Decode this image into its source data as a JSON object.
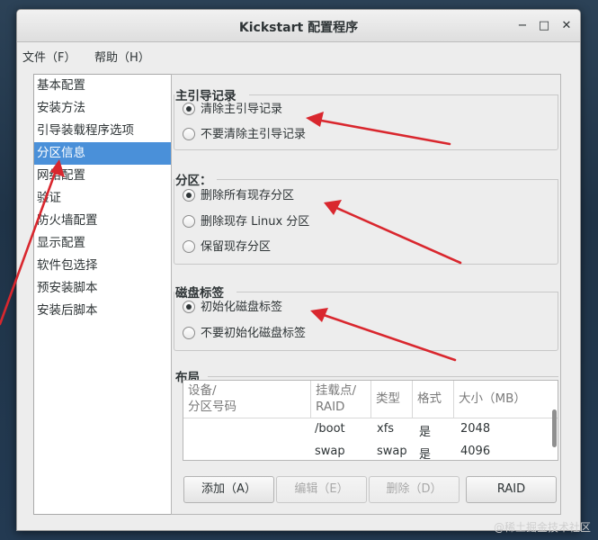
{
  "window": {
    "title": "Kickstart 配置程序"
  },
  "window_controls": {
    "minimize": "−",
    "maximize": "□",
    "close": "✕"
  },
  "menubar": {
    "file": "文件（F）",
    "help": "帮助（H）"
  },
  "sidebar": {
    "items": [
      "基本配置",
      "安装方法",
      "引导装载程序选项",
      "分区信息",
      "网络配置",
      "验证",
      "防火墙配置",
      "显示配置",
      "软件包选择",
      "预安装脚本",
      "安装后脚本"
    ],
    "selected_index": 3
  },
  "mbr": {
    "title": "主引导记录",
    "options": [
      "清除主引导记录",
      "不要清除主引导记录"
    ],
    "selected": 0
  },
  "partitions": {
    "title": "分区：",
    "options": [
      "删除所有现存分区",
      "删除现存 Linux 分区",
      "保留现存分区"
    ],
    "selected": 0
  },
  "disklabel": {
    "title": "磁盘标签",
    "options": [
      "初始化磁盘标签",
      "不要初始化磁盘标签"
    ],
    "selected": 0
  },
  "layout": {
    "title": "布局",
    "columns": [
      "设备/\n分区号码",
      "挂载点/\nRAID",
      "类型",
      "格式",
      "大小（MB）"
    ],
    "rows": [
      {
        "mount": "/boot",
        "type": "xfs",
        "format": "是",
        "size": "2048"
      },
      {
        "mount": "swap",
        "type": "swap",
        "format": "是",
        "size": "4096"
      }
    ]
  },
  "buttons": {
    "add": "添加（A）",
    "edit": "编辑（E）",
    "delete": "删除（D）",
    "raid": "RAID"
  },
  "watermark": "@稀土掘金技术社区",
  "colors": {
    "accent": "#4a90d9",
    "arrow": "#d9272e"
  }
}
